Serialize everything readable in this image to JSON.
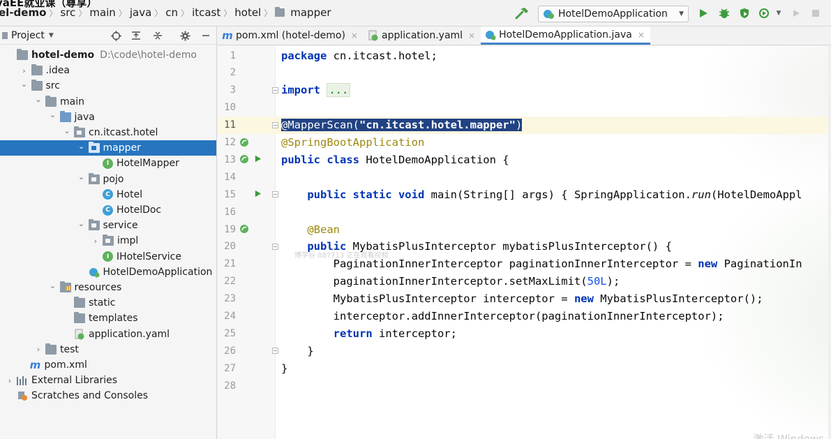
{
  "watermark": "vaEE就业课（尊享）",
  "breadcrumb": [
    "el-demo",
    "src",
    "main",
    "java",
    "cn",
    "itcast",
    "hotel",
    "mapper"
  ],
  "toolbar": {
    "run_config": "HotelDemoApplication",
    "icons": [
      "hammer-icon",
      "run-icon",
      "debug-icon",
      "coverage-icon",
      "profile-icon",
      "stop-icon"
    ]
  },
  "project_panel": {
    "title": "Project",
    "header_icons": [
      "locate-icon",
      "expand-all-icon",
      "collapse-all-icon",
      "gear-icon",
      "minimize-icon"
    ],
    "tree": [
      {
        "label": "hotel-demo",
        "hint": "D:\\code\\hotel-demo",
        "kind": "project",
        "depth": 0,
        "arrow": "",
        "bold": true
      },
      {
        "label": ".idea",
        "kind": "folder",
        "depth": 1,
        "arrow": "›"
      },
      {
        "label": "src",
        "kind": "folder",
        "depth": 1,
        "arrow": "⌄"
      },
      {
        "label": "main",
        "kind": "folder",
        "depth": 2,
        "arrow": "⌄"
      },
      {
        "label": "java",
        "kind": "folder-blue",
        "depth": 3,
        "arrow": "⌄"
      },
      {
        "label": "cn.itcast.hotel",
        "kind": "package",
        "depth": 4,
        "arrow": "⌄"
      },
      {
        "label": "mapper",
        "kind": "package",
        "depth": 5,
        "arrow": "⌄",
        "selected": true
      },
      {
        "label": "HotelMapper",
        "kind": "interface",
        "depth": 6,
        "arrow": ""
      },
      {
        "label": "pojo",
        "kind": "package",
        "depth": 5,
        "arrow": "⌄"
      },
      {
        "label": "Hotel",
        "kind": "class",
        "depth": 6,
        "arrow": ""
      },
      {
        "label": "HotelDoc",
        "kind": "class",
        "depth": 6,
        "arrow": ""
      },
      {
        "label": "service",
        "kind": "package",
        "depth": 5,
        "arrow": "⌄"
      },
      {
        "label": "impl",
        "kind": "package",
        "depth": 6,
        "arrow": "›"
      },
      {
        "label": "IHotelService",
        "kind": "interface",
        "depth": 6,
        "arrow": ""
      },
      {
        "label": "HotelDemoApplication",
        "kind": "spring-class",
        "depth": 5,
        "arrow": ""
      },
      {
        "label": "resources",
        "kind": "resources",
        "depth": 3,
        "arrow": "⌄"
      },
      {
        "label": "static",
        "kind": "folder",
        "depth": 4,
        "arrow": ""
      },
      {
        "label": "templates",
        "kind": "folder",
        "depth": 4,
        "arrow": ""
      },
      {
        "label": "application.yaml",
        "kind": "yaml",
        "depth": 4,
        "arrow": ""
      },
      {
        "label": "test",
        "kind": "folder",
        "depth": 2,
        "arrow": "›"
      },
      {
        "label": "pom.xml",
        "kind": "maven",
        "depth": 1,
        "arrow": ""
      },
      {
        "label": "External Libraries",
        "kind": "libraries",
        "depth": 0,
        "arrow": "›"
      },
      {
        "label": "Scratches and Consoles",
        "kind": "scratches",
        "depth": 0,
        "arrow": ""
      }
    ]
  },
  "tabs": [
    {
      "label": "pom.xml (hotel-demo)",
      "icon": "maven-icon",
      "active": false
    },
    {
      "label": "application.yaml",
      "icon": "yaml-icon",
      "active": false
    },
    {
      "label": "HotelDemoApplication.java",
      "icon": "spring-class-icon",
      "active": true
    }
  ],
  "editor": {
    "current_line": 11,
    "lines": [
      {
        "n": "1",
        "html": "<span class=\"kw\">package</span> cn.itcast.hotel;"
      },
      {
        "n": "2",
        "html": ""
      },
      {
        "n": "3",
        "html": "<span class=\"kw\">import</span> <span class=\"fold-dots\">...</span>",
        "fold": true
      },
      {
        "n": "10",
        "html": ""
      },
      {
        "n": "11",
        "html": "<span class=\"sel\"><span class=\"ann\" style=\"color:#fff\">@MapperScan</span>(<span class=\"str\">\"cn.itcast.hotel.mapper\"</span>)</span>",
        "fold": true
      },
      {
        "n": "12",
        "html": "<span class=\"ann\">@SpringBootApplication</span>",
        "gicon": "spring-bean-icon"
      },
      {
        "n": "13",
        "html": "<span class=\"kw\">public class</span> HotelDemoApplication {",
        "gicon": "spring-bean-icon",
        "run": true
      },
      {
        "n": "14",
        "html": ""
      },
      {
        "n": "15",
        "html": "    <span class=\"kw\">public static void</span> main(String[] args) { SpringApplication.<span class=\"it\">run</span>(HotelDemoAppl",
        "run": true,
        "fold": true
      },
      {
        "n": "16",
        "html": ""
      },
      {
        "n": "19",
        "html": "    <span class=\"ann\">@Bean</span>",
        "gicon": "spring-bean-icon"
      },
      {
        "n": "20",
        "html": "    <span class=\"kw\">public</span> MybatisPlusInterceptor mybatisPlusInterceptor() {",
        "fold": true
      },
      {
        "n": "21",
        "html": "        PaginationInnerInterceptor paginationInnerInterceptor = <span class=\"kw\">new</span> PaginationIn"
      },
      {
        "n": "22",
        "html": "        paginationInnerInterceptor.setMaxLimit(<span class=\"num\">50L</span>);"
      },
      {
        "n": "23",
        "html": "        MybatisPlusInterceptor interceptor = <span class=\"kw\">new</span> MybatisPlusInterceptor();"
      },
      {
        "n": "24",
        "html": "        interceptor.addInnerInterceptor(paginationInnerInterceptor);"
      },
      {
        "n": "25",
        "html": "        <span class=\"kw\">return</span> interceptor;"
      },
      {
        "n": "26",
        "html": "    }",
        "fold": true
      },
      {
        "n": "27",
        "html": "}"
      },
      {
        "n": "28",
        "html": ""
      }
    ],
    "faint_overlay": "博学谷 887713 正在观看视频",
    "activate_text": "激活 Windows"
  }
}
